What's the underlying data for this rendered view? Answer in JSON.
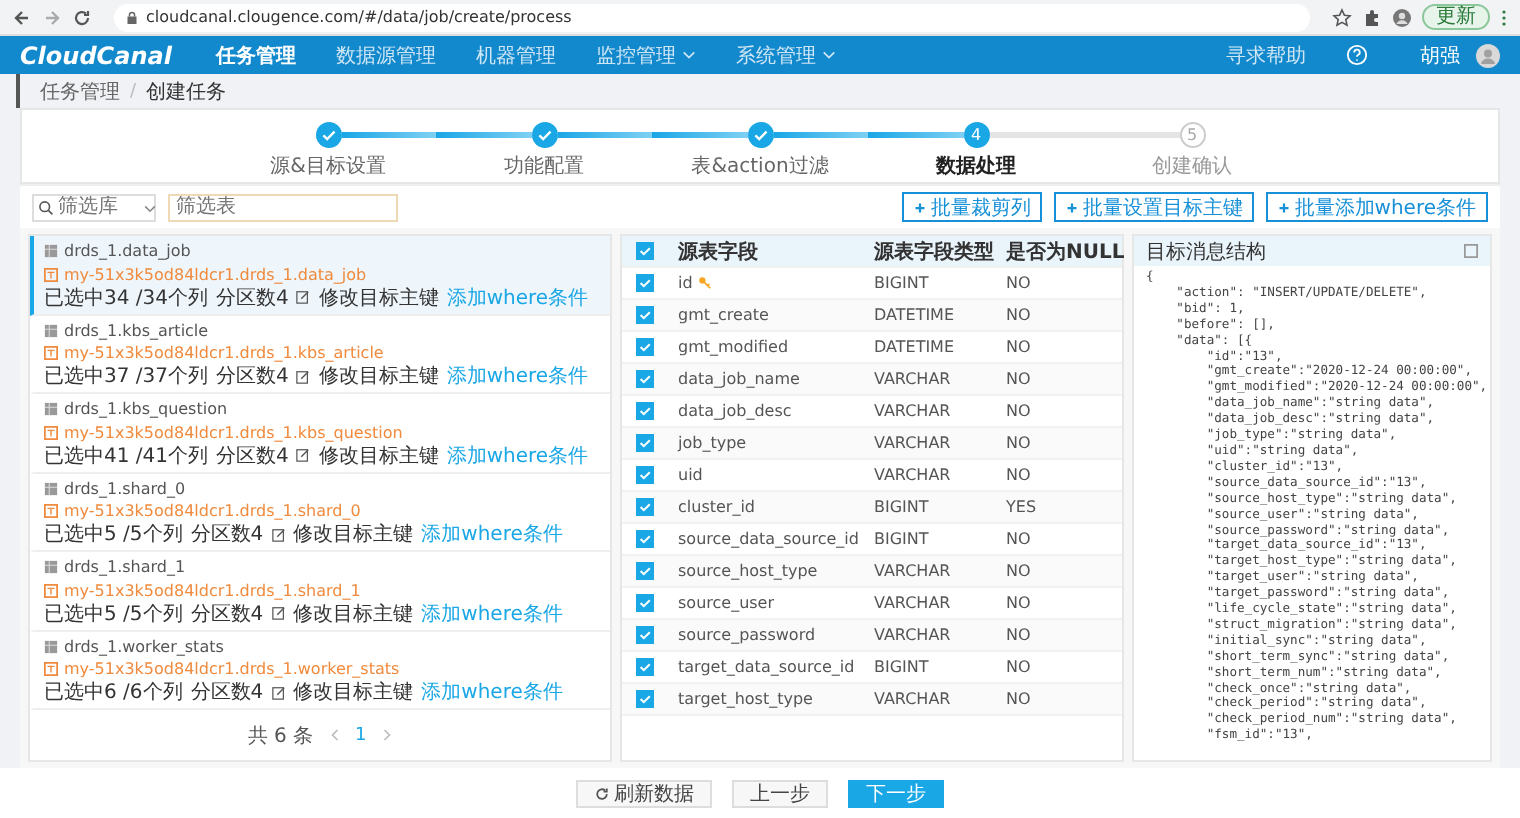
{
  "browser": {
    "url": "cloudcanal.clougence.com/#/data/job/create/process",
    "update_button": "更新"
  },
  "nav": {
    "logo": "CloudCanal",
    "items": [
      {
        "label": "任务管理",
        "selected": true,
        "dropdown": false
      },
      {
        "label": "数据源管理",
        "selected": false,
        "dropdown": false
      },
      {
        "label": "机器管理",
        "selected": false,
        "dropdown": false
      },
      {
        "label": "监控管理",
        "selected": false,
        "dropdown": true
      },
      {
        "label": "系统管理",
        "selected": false,
        "dropdown": true
      }
    ],
    "help": "寻求帮助",
    "user": "胡强"
  },
  "breadcrumb": {
    "items": [
      "任务管理",
      "创建任务"
    ],
    "separator": "/"
  },
  "steps": [
    {
      "label": "源&目标设置",
      "done": true,
      "current": false
    },
    {
      "label": "功能配置",
      "done": true,
      "current": false
    },
    {
      "label": "表&action过滤",
      "done": true,
      "current": false
    },
    {
      "label": "数据处理",
      "done": false,
      "current": true,
      "number": "4"
    },
    {
      "label": "创建确认",
      "done": false,
      "current": false,
      "number": "5"
    }
  ],
  "toolbar": {
    "db_filter": {
      "placeholder": "筛选库"
    },
    "table_filter": {
      "placeholder": "筛选表"
    },
    "buttons": [
      "批量裁剪列",
      "批量设置目标主键",
      "批量添加where条件"
    ]
  },
  "tables": [
    {
      "name": "drds_1.data_job",
      "target": "my-51x3k5od84ldcr1.drds_1.data_job",
      "columns": "已选中34 /34个列",
      "partitions": "分区数4",
      "edit_pk": "修改目标主键",
      "add_where": "添加where条件",
      "selected": true
    },
    {
      "name": "drds_1.kbs_article",
      "target": "my-51x3k5od84ldcr1.drds_1.kbs_article",
      "columns": "已选中37 /37个列",
      "partitions": "分区数4",
      "edit_pk": "修改目标主键",
      "add_where": "添加where条件",
      "selected": false
    },
    {
      "name": "drds_1.kbs_question",
      "target": "my-51x3k5od84ldcr1.drds_1.kbs_question",
      "columns": "已选中41 /41个列",
      "partitions": "分区数4",
      "edit_pk": "修改目标主键",
      "add_where": "添加where条件",
      "selected": false
    },
    {
      "name": "drds_1.shard_0",
      "target": "my-51x3k5od84ldcr1.drds_1.shard_0",
      "columns": "已选中5 /5个列",
      "partitions": "分区数4",
      "edit_pk": "修改目标主键",
      "add_where": "添加where条件",
      "selected": false
    },
    {
      "name": "drds_1.shard_1",
      "target": "my-51x3k5od84ldcr1.drds_1.shard_1",
      "columns": "已选中5 /5个列",
      "partitions": "分区数4",
      "edit_pk": "修改目标主键",
      "add_where": "添加where条件",
      "selected": false
    },
    {
      "name": "drds_1.worker_stats",
      "target": "my-51x3k5od84ldcr1.drds_1.worker_stats",
      "columns": "已选中6 /6个列",
      "partitions": "分区数4",
      "edit_pk": "修改目标主键",
      "add_where": "添加where条件",
      "selected": false
    }
  ],
  "pagination": {
    "total": "共 6 条",
    "page": "1"
  },
  "fields": {
    "columns": [
      "源表字段",
      "源表字段类型",
      "是否为NULL"
    ],
    "all_checked": true,
    "rows": [
      {
        "name": "id",
        "type": "BIGINT",
        "nullable": "NO",
        "checked": true,
        "key": true
      },
      {
        "name": "gmt_create",
        "type": "DATETIME",
        "nullable": "NO",
        "checked": true,
        "key": false
      },
      {
        "name": "gmt_modified",
        "type": "DATETIME",
        "nullable": "NO",
        "checked": true,
        "key": false
      },
      {
        "name": "data_job_name",
        "type": "VARCHAR",
        "nullable": "NO",
        "checked": true,
        "key": false
      },
      {
        "name": "data_job_desc",
        "type": "VARCHAR",
        "nullable": "NO",
        "checked": true,
        "key": false
      },
      {
        "name": "job_type",
        "type": "VARCHAR",
        "nullable": "NO",
        "checked": true,
        "key": false
      },
      {
        "name": "uid",
        "type": "VARCHAR",
        "nullable": "NO",
        "checked": true,
        "key": false
      },
      {
        "name": "cluster_id",
        "type": "BIGINT",
        "nullable": "YES",
        "checked": true,
        "key": false
      },
      {
        "name": "source_data_source_id",
        "type": "BIGINT",
        "nullable": "NO",
        "checked": true,
        "key": false
      },
      {
        "name": "source_host_type",
        "type": "VARCHAR",
        "nullable": "NO",
        "checked": true,
        "key": false
      },
      {
        "name": "source_user",
        "type": "VARCHAR",
        "nullable": "NO",
        "checked": true,
        "key": false
      },
      {
        "name": "source_password",
        "type": "VARCHAR",
        "nullable": "NO",
        "checked": true,
        "key": false
      },
      {
        "name": "target_data_source_id",
        "type": "BIGINT",
        "nullable": "NO",
        "checked": true,
        "key": false
      },
      {
        "name": "target_host_type",
        "type": "VARCHAR",
        "nullable": "NO",
        "checked": true,
        "key": false
      }
    ]
  },
  "message": {
    "title": "目标消息结构",
    "lines": [
      "{",
      "    \"action\": \"INSERT/UPDATE/DELETE\",",
      "    \"bid\": 1,",
      "    \"before\": [],",
      "    \"data\": [{",
      "        \"id\":\"13\",",
      "        \"gmt_create\":\"2020-12-24 00:00:00\",",
      "        \"gmt_modified\":\"2020-12-24 00:00:00\",",
      "        \"data_job_name\":\"string data\",",
      "        \"data_job_desc\":\"string data\",",
      "        \"job_type\":\"string data\",",
      "        \"uid\":\"string data\",",
      "        \"cluster_id\":\"13\",",
      "        \"source_data_source_id\":\"13\",",
      "        \"source_host_type\":\"string data\",",
      "        \"source_user\":\"string data\",",
      "        \"source_password\":\"string data\",",
      "        \"target_data_source_id\":\"13\",",
      "        \"target_host_type\":\"string data\",",
      "        \"target_user\":\"string data\",",
      "        \"target_password\":\"string data\",",
      "        \"life_cycle_state\":\"string data\",",
      "        \"struct_migration\":\"string data\",",
      "        \"initial_sync\":\"string data\",",
      "        \"short_term_sync\":\"string data\",",
      "        \"short_term_num\":\"string data\",",
      "        \"check_once\":\"string data\",",
      "        \"check_period\":\"string data\",",
      "        \"check_period_num\":\"string data\",",
      "        \"fsm_id\":\"13\","
    ]
  },
  "footer": {
    "refresh": "刷新数据",
    "prev": "上一步",
    "next": "下一步"
  }
}
